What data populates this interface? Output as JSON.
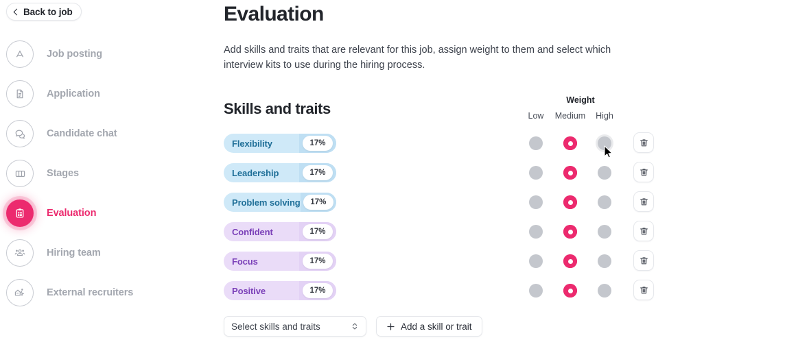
{
  "colors": {
    "accent": "#ec2a6e",
    "skill_pill_bg": "#cfe9f8",
    "skill_pill_text": "#1f6f98",
    "trait_pill_bg": "#eadcf8",
    "trait_pill_text": "#7a3fb8",
    "radio_unselected": "#c4c7cd",
    "heading": "#22252b",
    "muted_nav": "#a3a7af"
  },
  "sidebar": {
    "back_button": {
      "label": "Back to job",
      "icon": "chevron-left-icon"
    },
    "items": [
      {
        "label": "Job posting",
        "icon": "letter-a-icon",
        "active": false
      },
      {
        "label": "Application",
        "icon": "document-icon",
        "active": false
      },
      {
        "label": "Candidate chat",
        "icon": "chat-bubbles-icon",
        "active": false
      },
      {
        "label": "Stages",
        "icon": "columns-icon",
        "active": false
      },
      {
        "label": "Evaluation",
        "icon": "clipboard-icon",
        "active": true
      },
      {
        "label": "Hiring team",
        "icon": "people-icon",
        "active": false
      },
      {
        "label": "External recruiters",
        "icon": "recruiter-icon",
        "active": false
      }
    ]
  },
  "main": {
    "title": "Evaluation",
    "description": "Add skills and traits that are relevant for this job, assign weight to them and select which interview kits to use during the hiring process.",
    "section_title": "Skills and traits",
    "weight_header": {
      "title": "Weight",
      "columns": [
        "Low",
        "Medium",
        "High"
      ]
    },
    "rows": [
      {
        "name": "Flexibility",
        "weight_value": "17%",
        "kind": "skill",
        "selected": "Medium",
        "hovered": "High",
        "delete_icon": "trash-icon"
      },
      {
        "name": "Leadership",
        "weight_value": "17%",
        "kind": "skill",
        "selected": "Medium",
        "hovered": null,
        "delete_icon": "trash-icon"
      },
      {
        "name": "Problem solving",
        "weight_value": "17%",
        "kind": "skill",
        "selected": "Medium",
        "hovered": null,
        "delete_icon": "trash-icon"
      },
      {
        "name": "Confident",
        "weight_value": "17%",
        "kind": "trait",
        "selected": "Medium",
        "hovered": null,
        "delete_icon": "trash-icon"
      },
      {
        "name": "Focus",
        "weight_value": "17%",
        "kind": "trait",
        "selected": "Medium",
        "hovered": null,
        "delete_icon": "trash-icon"
      },
      {
        "name": "Positive",
        "weight_value": "17%",
        "kind": "trait",
        "selected": "Medium",
        "hovered": null,
        "delete_icon": "trash-icon"
      }
    ],
    "footer": {
      "select": {
        "value": "Select skills and traits",
        "icon": "chevron-up-down-icon"
      },
      "add_button": {
        "label": "Add a skill or trait",
        "icon": "plus-icon"
      }
    }
  }
}
